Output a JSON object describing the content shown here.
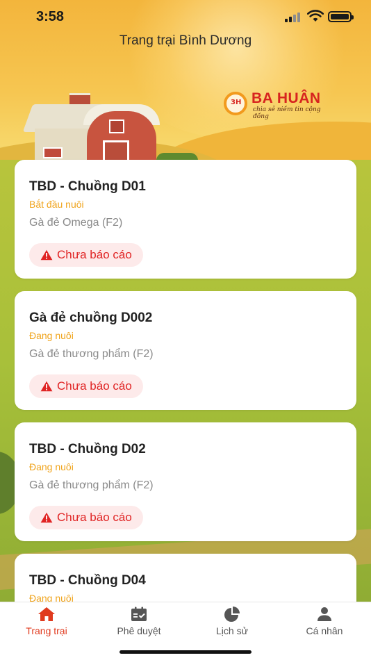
{
  "status_bar": {
    "time": "3:58"
  },
  "header": {
    "title": "Trang trại Bình Dương"
  },
  "logo": {
    "name": "BA HUÂN",
    "tagline": "chia sẻ niềm tin cộng đồng",
    "mark": "3H"
  },
  "colors": {
    "accent": "#e03a1e",
    "status_orange": "#f0a41c",
    "warning_red": "#e02424",
    "badge_bg": "#fdeaea"
  },
  "cards": [
    {
      "name": "TBD - Chuồng D01",
      "status": "Bắt đầu nuôi",
      "type": "Gà đẻ Omega (F2)",
      "badge": "Chưa báo cáo"
    },
    {
      "name": "Gà đẻ chuồng D002",
      "status": "Đang nuôi",
      "type": "Gà đẻ thương phẩm (F2)",
      "badge": "Chưa báo cáo"
    },
    {
      "name": "TBD - Chuồng D02",
      "status": "Đang nuôi",
      "type": "Gà đẻ thương phẩm (F2)",
      "badge": "Chưa báo cáo"
    },
    {
      "name": "TBD - Chuồng D04",
      "status": "Đang nuôi",
      "type": "",
      "badge": ""
    }
  ],
  "tabs": [
    {
      "label": "Trang trại",
      "icon": "home-icon",
      "active": true
    },
    {
      "label": "Phê duyệt",
      "icon": "calendar-check-icon",
      "active": false
    },
    {
      "label": "Lịch sử",
      "icon": "pie-chart-icon",
      "active": false
    },
    {
      "label": "Cá nhân",
      "icon": "person-icon",
      "active": false
    }
  ]
}
